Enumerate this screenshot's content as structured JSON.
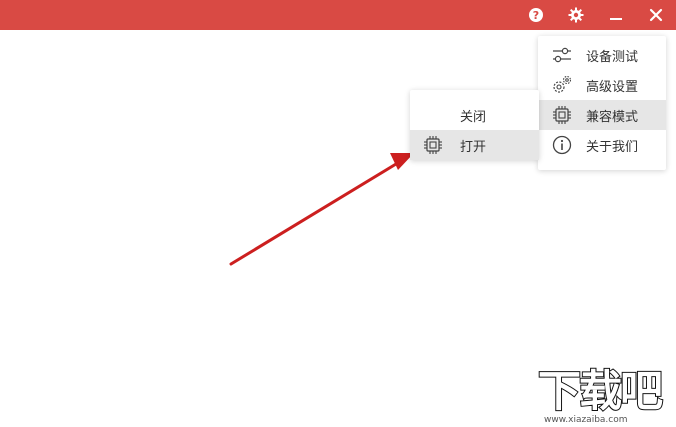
{
  "window": {
    "accent_color": "#d94a44",
    "buttons": [
      {
        "name": "help-icon"
      },
      {
        "name": "gear-icon"
      },
      {
        "name": "minimize-icon"
      },
      {
        "name": "close-icon"
      }
    ]
  },
  "main_menu": {
    "items": [
      {
        "label": "设备测试",
        "icon": "sliders-icon",
        "selected": false
      },
      {
        "label": "高级设置",
        "icon": "gears-icon",
        "selected": false
      },
      {
        "label": "兼容模式",
        "icon": "chip-icon",
        "selected": true
      },
      {
        "label": "关于我们",
        "icon": "info-icon",
        "selected": false
      }
    ]
  },
  "sub_menu": {
    "items": [
      {
        "label": "关闭",
        "icon": "",
        "selected": false
      },
      {
        "label": "打开",
        "icon": "chip-icon",
        "selected": true
      }
    ]
  },
  "annotation": {
    "arrow_color": "#cc1f1f"
  },
  "watermark": {
    "brand": "下载吧",
    "url": "www.xiazaiba.com"
  }
}
